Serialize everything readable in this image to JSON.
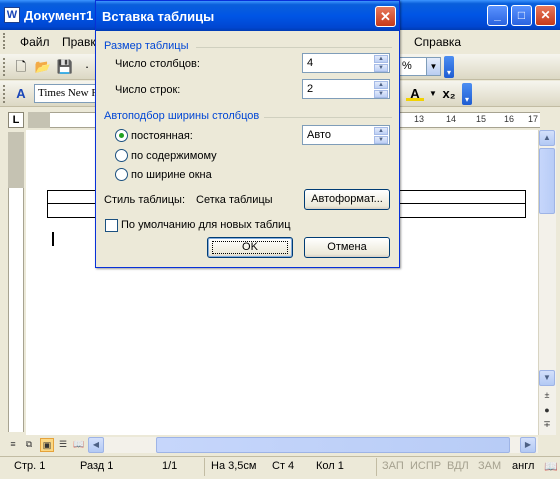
{
  "window": {
    "title": "Документ1",
    "app_icon": "word-document-icon"
  },
  "menu": [
    "Файл",
    "Правка",
    "Справка"
  ],
  "toolbar": {
    "font_name": "Times New R",
    "zoom_partial": "%"
  },
  "ruler": {
    "numbers": [
      "13",
      "14",
      "15",
      "16",
      "17"
    ]
  },
  "dialog": {
    "title": "Вставка таблицы",
    "size_group": "Размер таблицы",
    "columns_label": "Число столбцов:",
    "columns_value": "4",
    "rows_label": "Число строк:",
    "rows_value": "2",
    "autofit_group": "Автоподбор ширины столбцов",
    "fixed_label": "постоянная:",
    "fixed_value": "Авто",
    "content_label": "по содержимому",
    "window_label": "по ширине окна",
    "style_label": "Стиль таблицы:",
    "style_value": "Сетка таблицы",
    "autoformat_button": "Автоформат...",
    "default_checkbox_label": "По умолчанию для новых таблиц",
    "default_checked": false,
    "selected_autofit": "fixed",
    "ok_button": "OK",
    "cancel_button": "Отмена"
  },
  "status": {
    "page": "Стр. 1",
    "section": "Разд 1",
    "pages": "1/1",
    "at": "На 3,5см",
    "line": "Ст 4",
    "col": "Кол 1",
    "rec": "ЗАП",
    "trk": "ИСПР",
    "ext": "ВДЛ",
    "ovr": "ЗАМ",
    "lang": "англ"
  }
}
